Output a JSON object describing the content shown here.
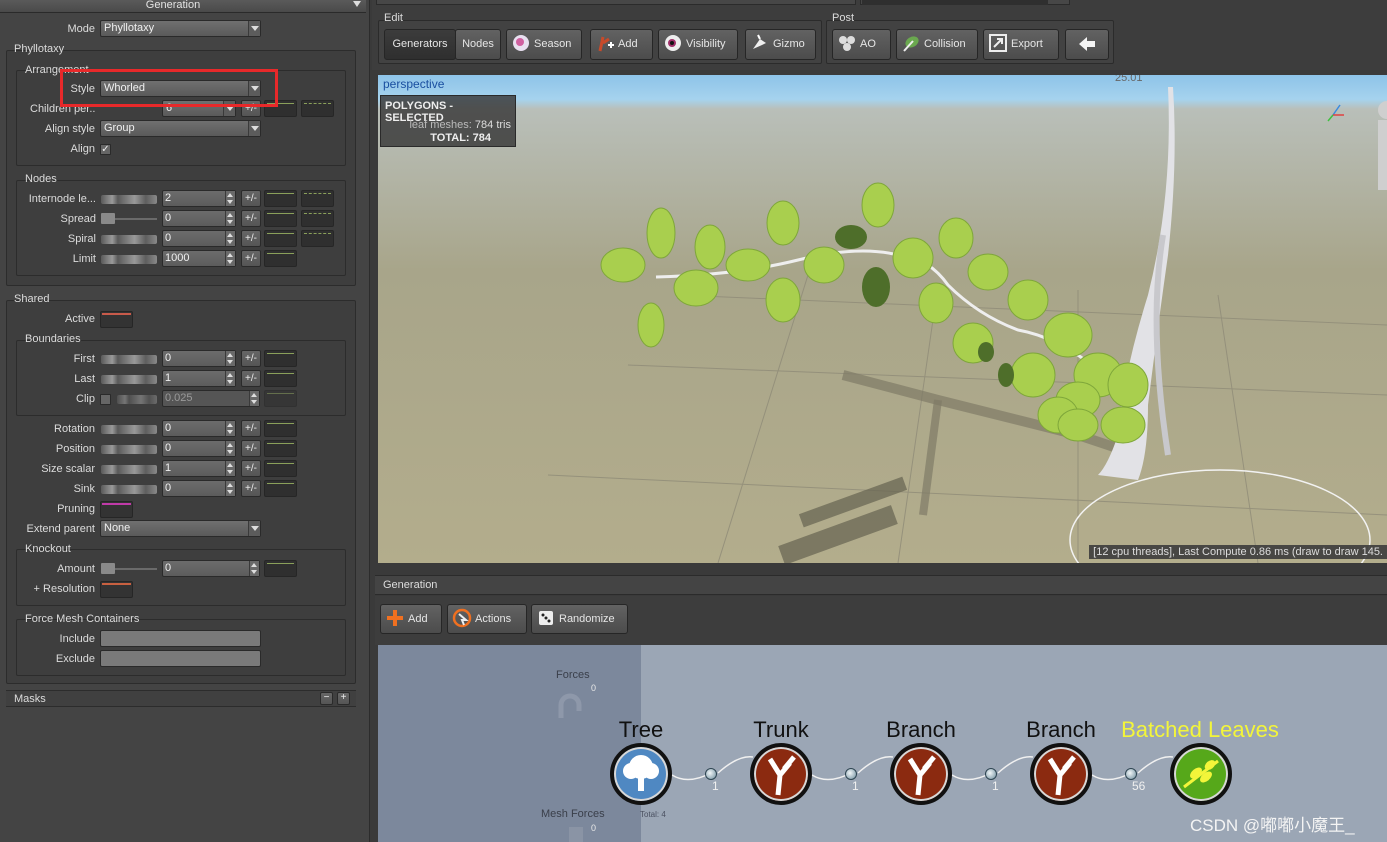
{
  "left_panel": {
    "title": "Generation",
    "mode_label": "Mode",
    "mode_value": "Phyllotaxy",
    "phyllotaxy": {
      "title": "Phyllotaxy",
      "arrangement": {
        "title": "Arrangement",
        "style_label": "Style",
        "style_value": "Whorled",
        "children_label": "Children per...",
        "children_value": "6",
        "align_style_label": "Align style",
        "align_style_value": "Group",
        "align_label": "Align",
        "align_checked": true
      },
      "nodes": {
        "title": "Nodes",
        "rows": [
          {
            "label": "Internode le...",
            "value": "2"
          },
          {
            "label": "Spread",
            "value": "0"
          },
          {
            "label": "Spiral",
            "value": "0"
          },
          {
            "label": "Limit",
            "value": "1000"
          }
        ]
      }
    },
    "shared": {
      "title": "Shared",
      "active_label": "Active",
      "boundaries_title": "Boundaries",
      "first_label": "First",
      "first_value": "0",
      "last_label": "Last",
      "last_value": "1",
      "clip_label": "Clip",
      "clip_value": "0.025",
      "rotation_label": "Rotation",
      "rotation_value": "0",
      "position_label": "Position",
      "position_value": "0",
      "size_scalar_label": "Size scalar",
      "size_scalar_value": "1",
      "sink_label": "Sink",
      "sink_value": "0",
      "pruning_label": "Pruning",
      "extend_parent_label": "Extend parent",
      "extend_parent_value": "None",
      "knockout_title": "Knockout",
      "amount_label": "Amount",
      "amount_value": "0",
      "resolution_label": "+ Resolution",
      "force_mesh_title": "Force Mesh Containers",
      "include_label": "Include",
      "exclude_label": "Exclude"
    },
    "masks_label": "Masks",
    "pm_label": "+/-"
  },
  "toolbar": {
    "edit_label": "Edit",
    "post_label": "Post",
    "generators": "Generators",
    "nodes": "Nodes",
    "season": "Season",
    "add": "Add",
    "visibility": "Visibility",
    "gizmo": "Gizmo",
    "ao": "AO",
    "collision": "Collision",
    "export": "Export"
  },
  "viewport": {
    "camera": "perspective",
    "stats_title": "POLYGONS - SELECTED",
    "leaf_meshes_label": "leaf meshes:",
    "leaf_meshes_value": "784 tris",
    "total_label": "TOTAL:",
    "total_value": "784",
    "ruler_value": "25.01",
    "status": "[12 cpu threads], Last Compute 0.86 ms (draw to draw 145."
  },
  "generation": {
    "title": "Generation",
    "add": "Add",
    "actions": "Actions",
    "randomize": "Randomize",
    "forces_label": "Forces",
    "forces_count": "0",
    "mesh_forces_label": "Mesh Forces",
    "mesh_forces_count": "0",
    "total_label": "Total: 4",
    "nodes": [
      {
        "name": "Tree"
      },
      {
        "name": "Trunk",
        "in_count": "1"
      },
      {
        "name": "Branch",
        "in_count": "1"
      },
      {
        "name": "Branch",
        "in_count": "1"
      },
      {
        "name": "Batched Leaves",
        "in_count": "56"
      }
    ],
    "colors": {
      "tree_node": "#4f88c2",
      "branch_node": "#8b2a10",
      "leaves_node": "#56a81a",
      "leaves_label": "#f3f53a"
    }
  },
  "watermark": "CSDN @嘟嘟小魔王_"
}
